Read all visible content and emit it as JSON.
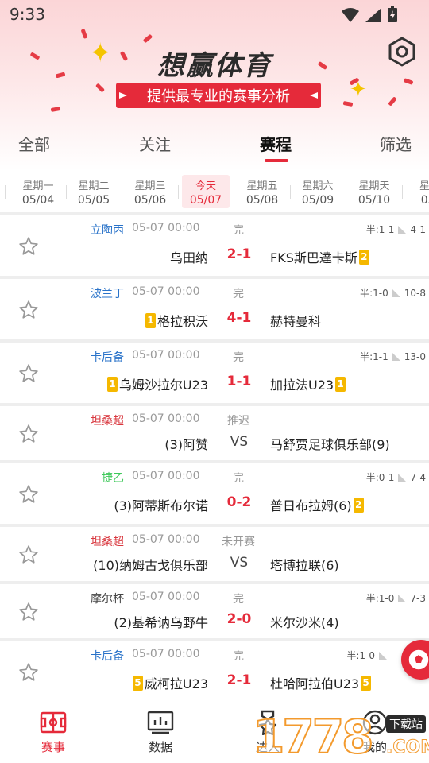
{
  "status_bar": {
    "time": "9:33"
  },
  "header": {
    "title": "想赢体育",
    "tagline": "提供最专业的赛事分析",
    "settings_icon": "gear-icon"
  },
  "tabs": [
    {
      "label": "全部"
    },
    {
      "label": "关注"
    },
    {
      "label": "赛程",
      "active": true
    },
    {
      "label": "筛选"
    }
  ],
  "days": [
    {
      "weekday": "星期一",
      "date": "05/04"
    },
    {
      "weekday": "星期二",
      "date": "05/05"
    },
    {
      "weekday": "星期三",
      "date": "05/06"
    },
    {
      "weekday": "今天",
      "date": "05/07",
      "today": true
    },
    {
      "weekday": "星期五",
      "date": "05/08"
    },
    {
      "weekday": "星期六",
      "date": "05/09"
    },
    {
      "weekday": "星期天",
      "date": "05/10"
    },
    {
      "weekday": "星期",
      "date": "05/"
    }
  ],
  "matches": [
    {
      "league": "立陶丙",
      "league_color": "#2a73c9",
      "time": "05-07 00:00",
      "status": "完",
      "home": "乌田纳",
      "home_badge": "",
      "score": "2-1",
      "away": "FKS斯巴達卡斯",
      "away_badge": "2",
      "half": "半:1-1",
      "corner": "4-1"
    },
    {
      "league": "波兰丁",
      "league_color": "#2a73c9",
      "time": "05-07 00:00",
      "status": "完",
      "home": "格拉积沃",
      "home_badge": "1",
      "score": "4-1",
      "away": "赫特曼科",
      "away_badge": "",
      "half": "半:1-0",
      "corner": "10-8"
    },
    {
      "league": "卡后备",
      "league_color": "#2a73c9",
      "time": "05-07 00:00",
      "status": "完",
      "home": "乌姆沙拉尔U23",
      "home_badge": "1",
      "score": "1-1",
      "away": "加拉法U23",
      "away_badge": "1",
      "half": "半:1-1",
      "corner": "13-0"
    },
    {
      "league": "坦桑超",
      "league_color": "#d9383f",
      "time": "05-07 00:00",
      "status": "推迟",
      "home": "(3)阿赞",
      "home_badge": "",
      "score": "VS",
      "away": "马舒贾足球俱乐部(9)",
      "away_badge": "",
      "half": "",
      "corner": ""
    },
    {
      "league": "捷乙",
      "league_color": "#3ec85a",
      "time": "05-07 00:00",
      "status": "完",
      "home": "(3)阿蒂斯布尔诺",
      "home_badge": "",
      "score": "0-2",
      "away": "普日布拉姆(6)",
      "away_badge": "2",
      "half": "半:0-1",
      "corner": "7-4"
    },
    {
      "league": "坦桑超",
      "league_color": "#d9383f",
      "time": "05-07 00:00",
      "status": "未开赛",
      "home": "(10)纳姆古戈俱乐部",
      "home_badge": "",
      "score": "VS",
      "away": "塔博拉联(6)",
      "away_badge": "",
      "half": "",
      "corner": ""
    },
    {
      "league": "摩尔杯",
      "league_color": "#444444",
      "time": "05-07 00:00",
      "status": "完",
      "home": "(2)基希讷乌野牛",
      "home_badge": "",
      "score": "2-0",
      "away": "米尔沙米(4)",
      "away_badge": "",
      "half": "半:1-0",
      "corner": "7-3"
    },
    {
      "league": "卡后备",
      "league_color": "#2a73c9",
      "time": "05-07 00:00",
      "status": "完",
      "home": "威柯拉U23",
      "home_badge": "5",
      "score": "2-1",
      "away": "杜哈阿拉伯U23",
      "away_badge": "5",
      "half": "半:1-0",
      "corner": ""
    }
  ],
  "bottom_nav": [
    {
      "label": "赛事",
      "icon": "pitch-icon",
      "active": true
    },
    {
      "label": "数据",
      "icon": "chart-board-icon"
    },
    {
      "label": "达人",
      "icon": "medal-icon"
    },
    {
      "label": "我的",
      "icon": "user-icon"
    }
  ],
  "watermark": {
    "digits": "1778",
    "tag": "下载站",
    "com": ".COM"
  },
  "colors": {
    "accent": "#e52a3a",
    "badge": "#f5b800"
  }
}
